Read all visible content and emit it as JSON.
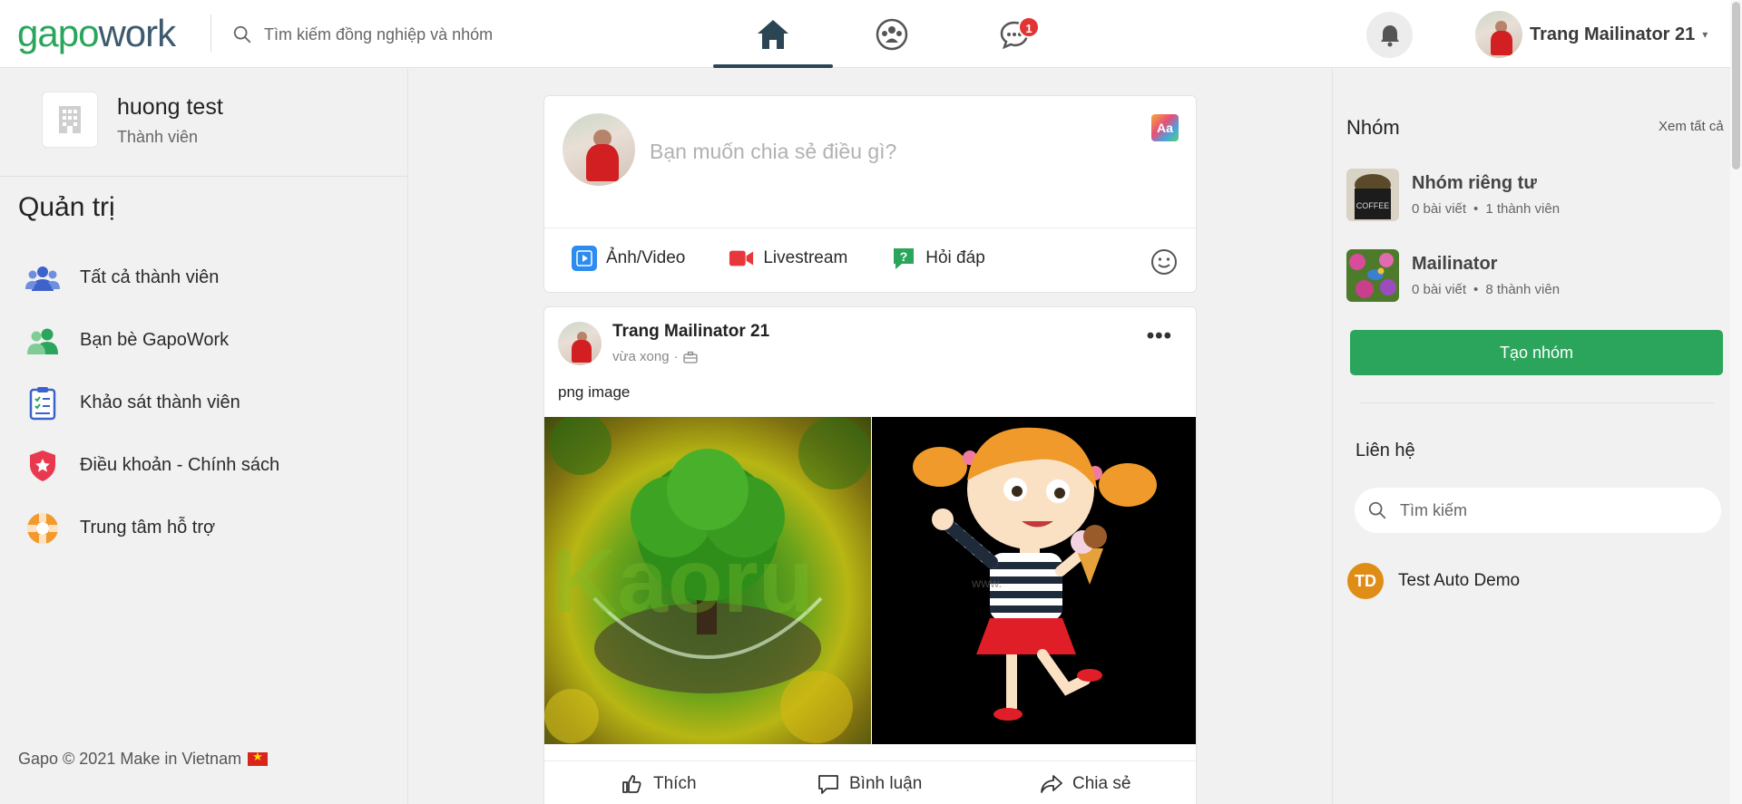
{
  "header": {
    "logo_part1": "gapo",
    "logo_part2": "work",
    "search_placeholder": "Tìm kiếm đồng nghiệp và nhóm",
    "chat_badge": "1",
    "user_name": "Trang Mailinator 21",
    "caret": "▾"
  },
  "left": {
    "org_name": "huong test",
    "org_role": "Thành viên",
    "admin_title": "Quản trị",
    "menu": [
      {
        "label": "Tất cả thành viên",
        "icon": "members-icon"
      },
      {
        "label": "Bạn bè GapoWork",
        "icon": "friends-icon"
      },
      {
        "label": "Khảo sát thành viên",
        "icon": "survey-icon"
      },
      {
        "label": "Điều khoản - Chính sách",
        "icon": "policy-shield-icon"
      },
      {
        "label": "Trung tâm hỗ trợ",
        "icon": "support-lifebuoy-icon"
      }
    ],
    "footer": "Gapo © 2021 Make in Vietnam"
  },
  "composer": {
    "placeholder": "Bạn muốn chia sẻ điều gì?",
    "aa": "Aa",
    "actions": [
      {
        "label": "Ảnh/Video",
        "color": "#2d8cf0"
      },
      {
        "label": "Livestream",
        "color": "#e8373c"
      },
      {
        "label": "Hỏi đáp",
        "color": "#2ba55b"
      }
    ]
  },
  "post": {
    "author": "Trang Mailinator 21",
    "time": "vừa xong",
    "separator": "·",
    "text": "png image",
    "watermark_left": "Kaoru",
    "watermark_right": "www.",
    "like": "Thích",
    "comment": "Bình luận",
    "share": "Chia sẻ"
  },
  "right": {
    "groups_title": "Nhóm",
    "see_all": "Xem tất cả",
    "groups": [
      {
        "name": "Nhóm riêng tư",
        "posts": "0 bài viết",
        "dot": "•",
        "members": "1 thành viên",
        "cup_label": "COFFEE"
      },
      {
        "name": "Mailinator",
        "posts": "0 bài viết",
        "dot": "•",
        "members": "8 thành viên"
      }
    ],
    "create_group": "Tạo nhóm",
    "contacts_title": "Liên hệ",
    "contacts_search_placeholder": "Tìm kiếm",
    "contacts": [
      {
        "initials": "TD",
        "name": "Test Auto Demo",
        "color": "#e08d17"
      }
    ]
  },
  "colors": {
    "brand_green": "#2ba55b",
    "brand_dark": "#3d5a6e",
    "badge_red": "#e23434"
  }
}
